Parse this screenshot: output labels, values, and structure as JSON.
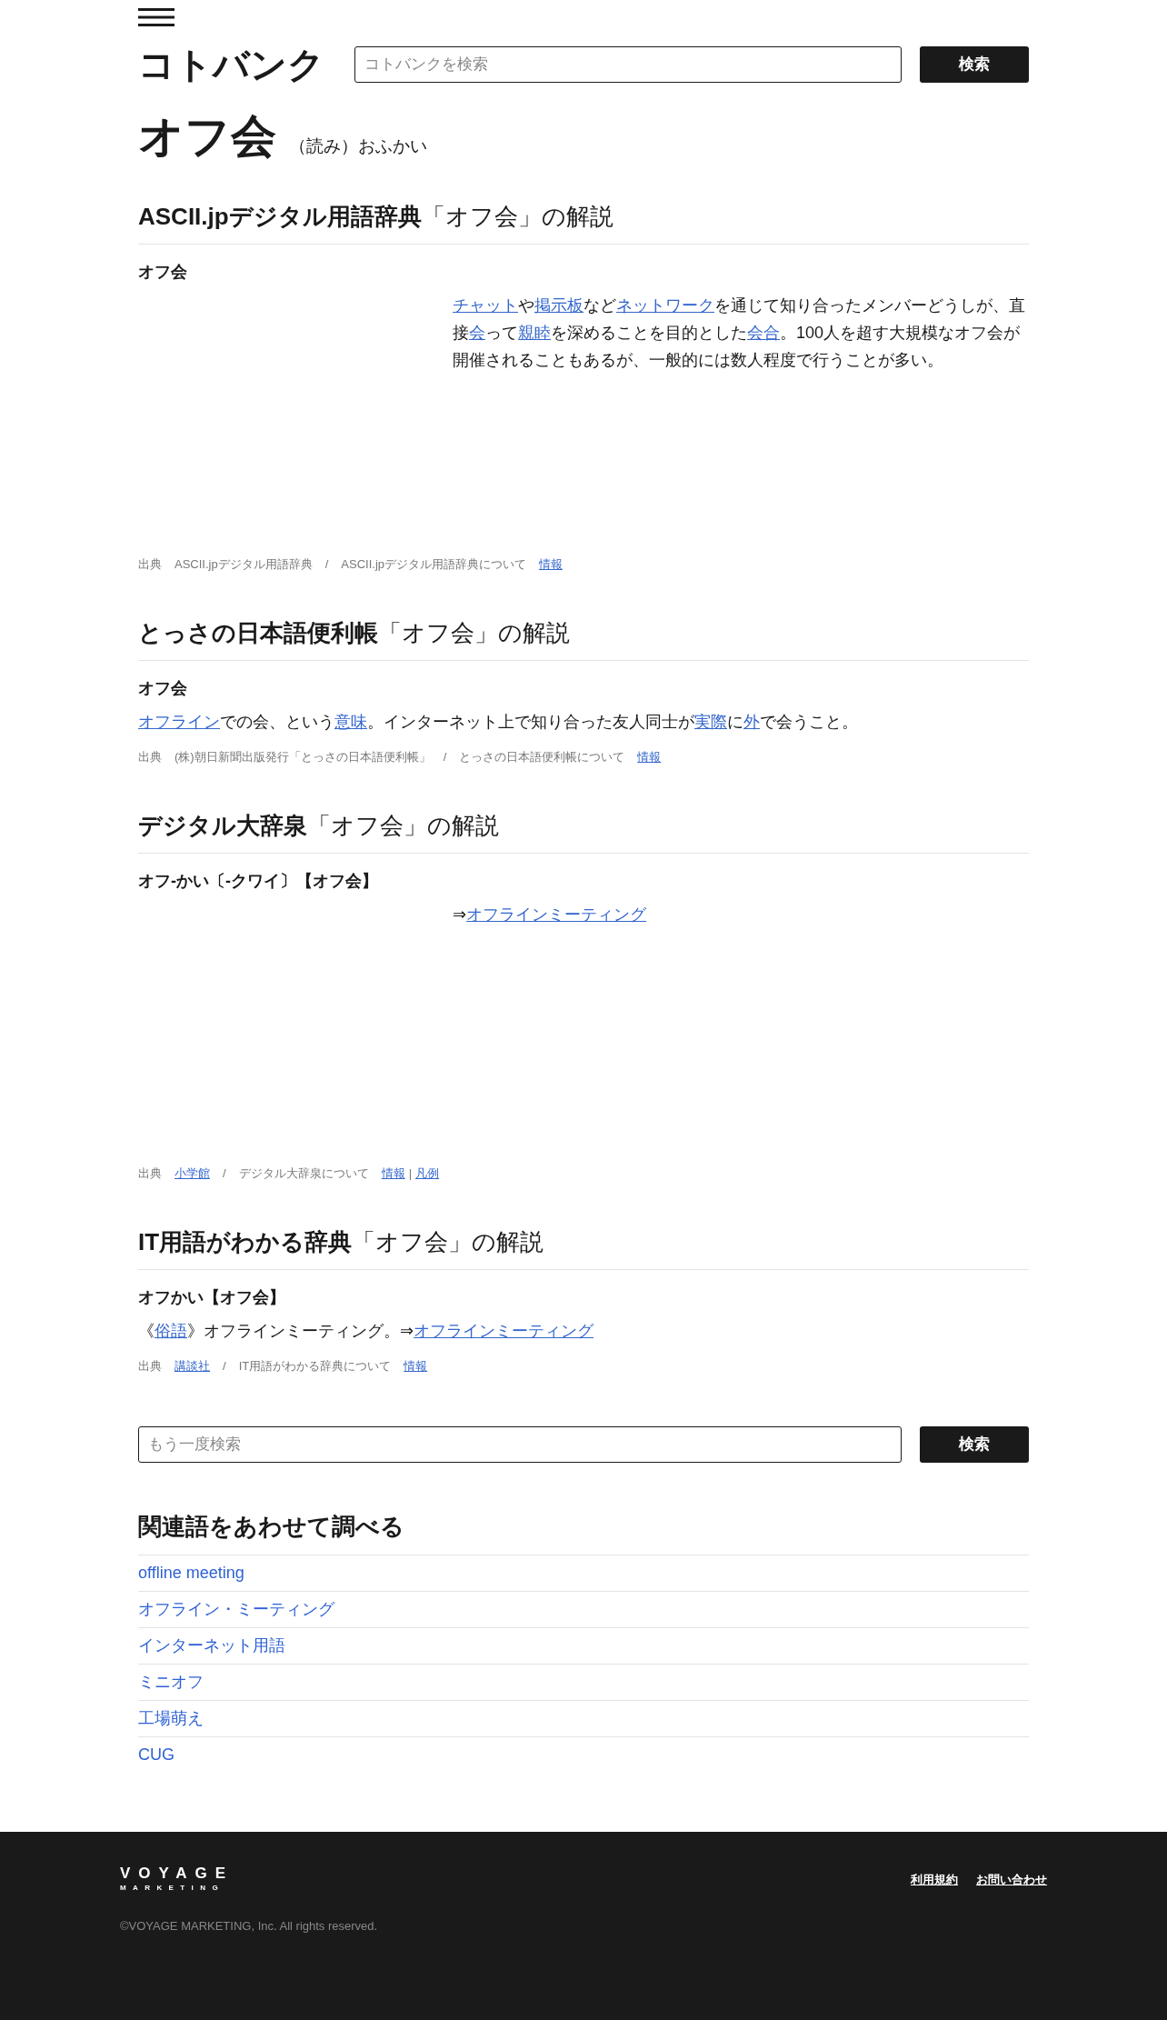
{
  "header": {
    "logo": "コトバンク",
    "search": {
      "placeholder": "コトバンクを検索"
    },
    "search_button": "検索"
  },
  "entry": {
    "title": "オフ会",
    "reading": "（読み）おふかい"
  },
  "sections": [
    {
      "dictionary": "ASCII.jpデジタル用語辞典",
      "heading_rest": "「オフ会」の解説",
      "term": "オフ会",
      "kind": "offset",
      "body": [
        {
          "text": "チャット",
          "link": true
        },
        {
          "text": "や",
          "link": false
        },
        {
          "text": "掲示板",
          "link": true
        },
        {
          "text": "など",
          "link": false
        },
        {
          "text": "ネットワーク",
          "link": true
        },
        {
          "text": "を通じて知り合ったメンバーどうしが、直接",
          "link": false
        },
        {
          "text": "会",
          "link": true
        },
        {
          "text": "って",
          "link": false
        },
        {
          "text": "親睦",
          "link": true
        },
        {
          "text": "を深めることを目的とした",
          "link": false
        },
        {
          "text": "会合",
          "link": true
        },
        {
          "text": "。100人を超す大規模なオフ会が開催されることもあるが、一般的には数人程度で行うことが多い。",
          "link": false
        }
      ],
      "source": [
        {
          "text": "出典",
          "kind": "text"
        },
        {
          "text": "ASCII.jpデジタル用語辞典",
          "kind": "text"
        },
        {
          "text": "/",
          "kind": "text"
        },
        {
          "text": "ASCII.jpデジタル用語辞典について",
          "kind": "text"
        },
        {
          "text": "情報",
          "kind": "link"
        }
      ]
    },
    {
      "dictionary": "とっさの日本語便利帳",
      "heading_rest": "「オフ会」の解説",
      "term": "オフ会",
      "kind": "full",
      "body": [
        {
          "text": "オフライン",
          "link": true
        },
        {
          "text": "での会、という",
          "link": false
        },
        {
          "text": "意味",
          "link": true
        },
        {
          "text": "。インターネット上で知り合った友人同士が",
          "link": false
        },
        {
          "text": "実際",
          "link": true
        },
        {
          "text": "に",
          "link": false
        },
        {
          "text": "外",
          "link": true
        },
        {
          "text": "で会うこと。",
          "link": false
        }
      ],
      "source": [
        {
          "text": "出典",
          "kind": "text"
        },
        {
          "text": "(株)朝日新聞出版発行「とっさの日本語便利帳」",
          "kind": "text"
        },
        {
          "text": "/",
          "kind": "text"
        },
        {
          "text": "とっさの日本語便利帳について",
          "kind": "text"
        },
        {
          "text": "情報",
          "kind": "link"
        }
      ]
    },
    {
      "dictionary": "デジタル大辞泉",
      "heading_rest": "「オフ会」の解説",
      "term": "オフ-かい〔-クワイ〕【オフ会】",
      "kind": "offset",
      "body": [
        {
          "text": "⇒",
          "link": false
        },
        {
          "text": "オフラインミーティング",
          "link": true
        }
      ],
      "source": [
        {
          "text": "出典",
          "kind": "text"
        },
        {
          "text": "小学館",
          "kind": "link"
        },
        {
          "text": "/",
          "kind": "text"
        },
        {
          "text": "デジタル大辞泉について",
          "kind": "text"
        },
        {
          "text": "情報",
          "kind": "link"
        },
        {
          "text": "|",
          "kind": "pipe"
        },
        {
          "text": "凡例",
          "kind": "link"
        }
      ]
    },
    {
      "dictionary": "IT用語がわかる辞典",
      "heading_rest": "「オフ会」の解説",
      "term": "オフかい【オフ会】",
      "kind": "full",
      "body": [
        {
          "text": "《",
          "link": false
        },
        {
          "text": "俗語",
          "link": true
        },
        {
          "text": "》オフラインミーティング。⇒",
          "link": false
        },
        {
          "text": "オフラインミーティング",
          "link": true
        }
      ],
      "source": [
        {
          "text": "出典",
          "kind": "text"
        },
        {
          "text": "講談社",
          "kind": "link"
        },
        {
          "text": "/",
          "kind": "text"
        },
        {
          "text": "IT用語がわかる辞典について",
          "kind": "text"
        },
        {
          "text": "情報",
          "kind": "link"
        }
      ]
    }
  ],
  "search_again": {
    "placeholder": "もう一度検索",
    "button": "検索"
  },
  "related": {
    "heading": "関連語をあわせて調べる",
    "items": [
      "offline meeting",
      "オフライン・ミーティング",
      "インターネット用語",
      "ミニオフ",
      "工場萌え",
      "CUG"
    ]
  },
  "footer": {
    "logo_top": "VOYAGE",
    "logo_bottom": "MARKETING",
    "links": [
      "利用規約",
      "お問い合わせ"
    ],
    "copyright": "©VOYAGE MARKETING, Inc. All rights reserved."
  }
}
